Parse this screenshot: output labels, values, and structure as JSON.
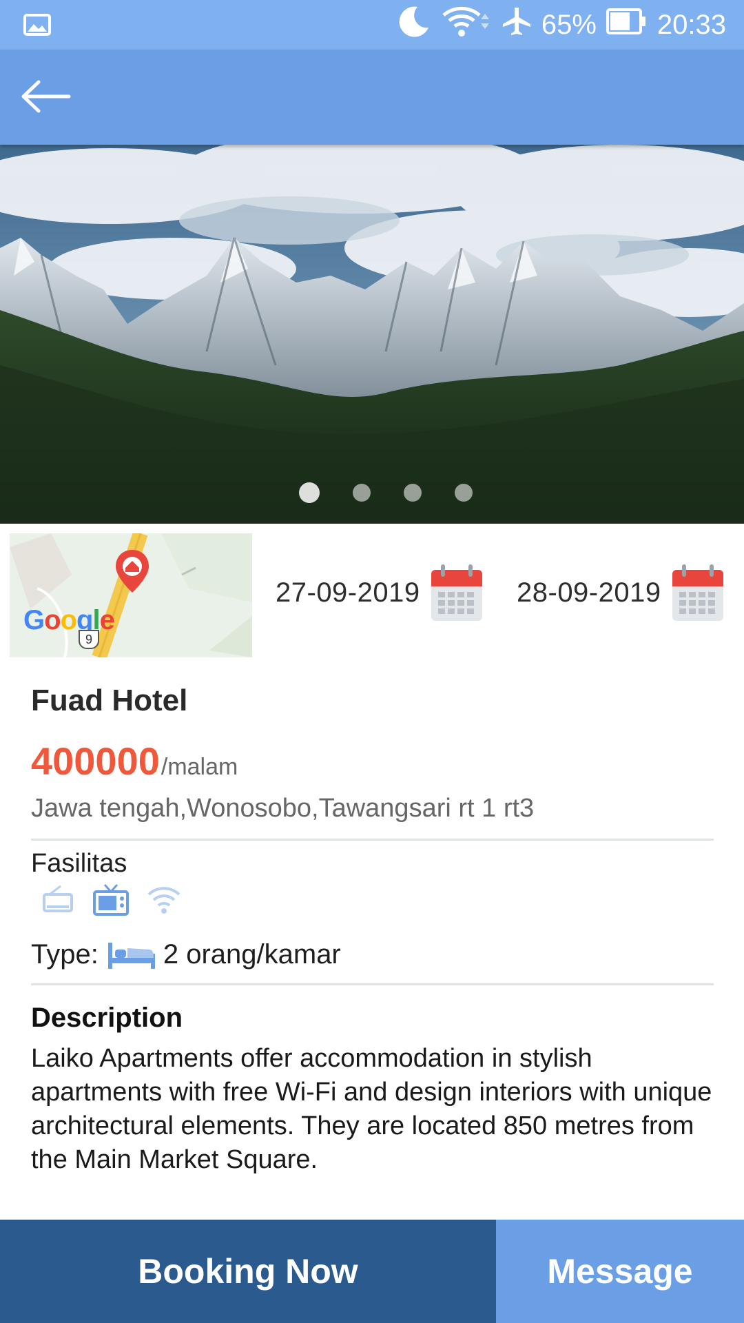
{
  "status_bar": {
    "battery": "65%",
    "time": "20:33",
    "icons": [
      "gallery-icon",
      "moon-icon",
      "wifi-icon",
      "airplane-icon",
      "battery-icon"
    ]
  },
  "app_bar": {
    "back_icon": "arrow-left-icon"
  },
  "carousel": {
    "slide_count": 4,
    "active_index": 0
  },
  "map": {
    "logo_text": "Google",
    "route_number": "9"
  },
  "dates": {
    "check_in": "27-09-2019",
    "check_out": "28-09-2019",
    "icon": "calendar-icon"
  },
  "hotel": {
    "name": "Fuad Hotel",
    "price": "400000",
    "price_unit": "/malam",
    "address": "Jawa tengah,Wonosobo,Tawangsari rt 1 rt3"
  },
  "facilities": {
    "label": "Fasilitas",
    "icons": [
      "radio-icon",
      "tv-icon",
      "wifi-icon"
    ]
  },
  "type": {
    "label": "Type:",
    "value": "2 orang/kamar",
    "icon": "bed-icon"
  },
  "description": {
    "title": "Description",
    "text": "Laiko Apartments offer accommodation in stylish apartments with free Wi-Fi and design interiors with unique architectural elements. They are located 850 metres from the Main Market Square."
  },
  "actions": {
    "booking_label": "Booking Now",
    "message_label": "Message"
  },
  "colors": {
    "status_bar": "#7fb0ef",
    "app_bar": "#6a9fe6",
    "price": "#f0583b",
    "booking_button": "#2b5a8e",
    "message_button": "#6a9fe6",
    "calendar_red": "#e8453c"
  }
}
